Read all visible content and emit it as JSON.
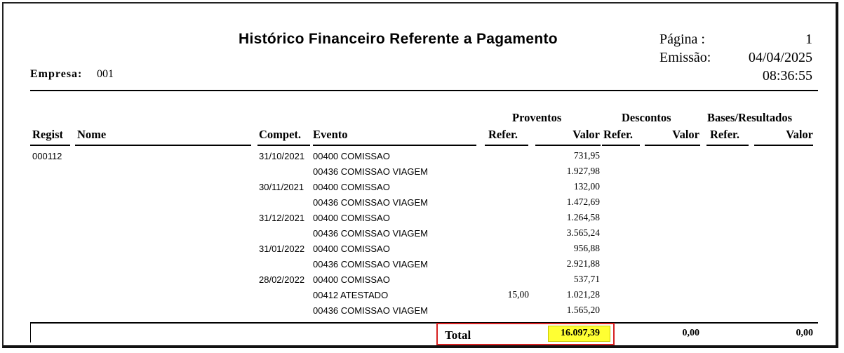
{
  "report": {
    "title": "Histórico Financeiro Referente a Pagamento",
    "page_label": "Página :",
    "page_number": "1",
    "issue_label": "Emissão:",
    "issue_date": "04/04/2025",
    "issue_time": "08:36:55",
    "company_label": "Empresa:",
    "company_code": "001"
  },
  "headers": {
    "groups": {
      "proventos": "Proventos",
      "descontos": "Descontos",
      "bases": "Bases/Resultados"
    },
    "regist": "Regist",
    "nome": "Nome",
    "compet": "Compet.",
    "evento": "Evento",
    "refer_proventos": "Refer.",
    "valor_proventos": "Valor",
    "refer_descontos": "Refer.",
    "valor_descontos": "Valor",
    "refer_bases": "Refer.",
    "valor_bases": "Valor"
  },
  "registro": "000112",
  "rows": [
    {
      "compet": "31/10/2021",
      "evento": "00400 COMISSAO",
      "refer": "",
      "valor": "731,95"
    },
    {
      "compet": "",
      "evento": "00436 COMISSAO  VIAGEM",
      "refer": "",
      "valor": "1.927,98"
    },
    {
      "compet": "30/11/2021",
      "evento": "00400 COMISSAO",
      "refer": "",
      "valor": "132,00"
    },
    {
      "compet": "",
      "evento": "00436 COMISSAO  VIAGEM",
      "refer": "",
      "valor": "1.472,69"
    },
    {
      "compet": "31/12/2021",
      "evento": "00400 COMISSAO",
      "refer": "",
      "valor": "1.264,58"
    },
    {
      "compet": "",
      "evento": "00436 COMISSAO  VIAGEM",
      "refer": "",
      "valor": "3.565,24"
    },
    {
      "compet": "31/01/2022",
      "evento": "00400 COMISSAO",
      "refer": "",
      "valor": "956,88"
    },
    {
      "compet": "",
      "evento": "00436 COMISSAO  VIAGEM",
      "refer": "",
      "valor": "2.921,88"
    },
    {
      "compet": "28/02/2022",
      "evento": "00400 COMISSAO",
      "refer": "",
      "valor": "537,71"
    },
    {
      "compet": "",
      "evento": "00412 ATESTADO",
      "refer": "15,00",
      "valor": "1.021,28"
    },
    {
      "compet": "",
      "evento": "00436 COMISSAO  VIAGEM",
      "refer": "",
      "valor": "1.565,20"
    }
  ],
  "totals": {
    "label": "Total",
    "proventos": "16.097,39",
    "descontos": "0,00",
    "bases": "0,00",
    "highlight_color": "#ffff33",
    "box_color": "#d62020"
  }
}
